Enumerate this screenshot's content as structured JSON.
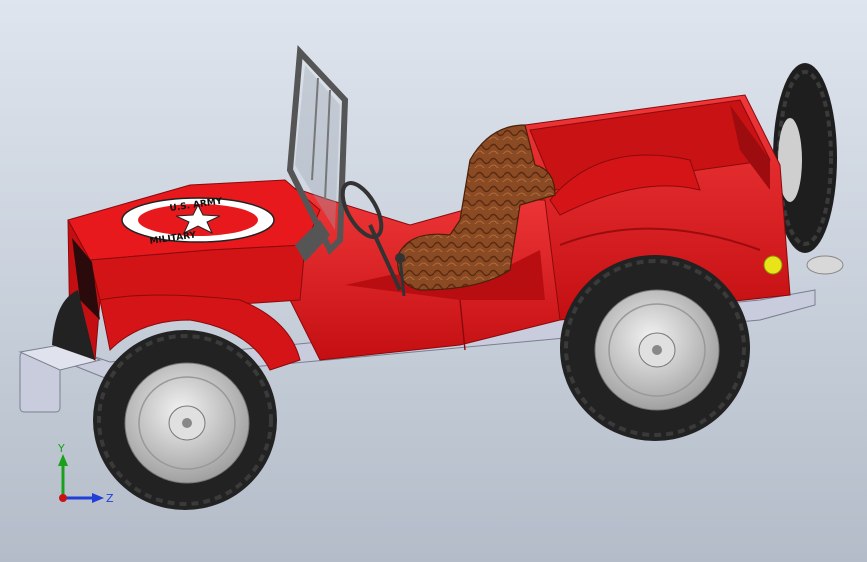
{
  "viewport": {
    "background_top": "#dfe5ee",
    "background_bottom": "#b4bcc9"
  },
  "model": {
    "body_color": "#e3171b",
    "body_shadow": "#b50d10",
    "chassis_color": "#c8ccdc",
    "tire_color": "#222222",
    "rim_color": "#c9c9c9",
    "seat_color": "#8a4a24",
    "taillight_color": "#e9e31a",
    "hood_emblem": {
      "icon": "star-icon",
      "text_top": "U.S. ARMY",
      "text_bottom": "MILITARY"
    }
  },
  "triad": {
    "y_label": "Y",
    "z_label": "Z",
    "y_color": "#1aa01a",
    "z_color": "#1f3fd6",
    "x_color": "#cc1111"
  }
}
